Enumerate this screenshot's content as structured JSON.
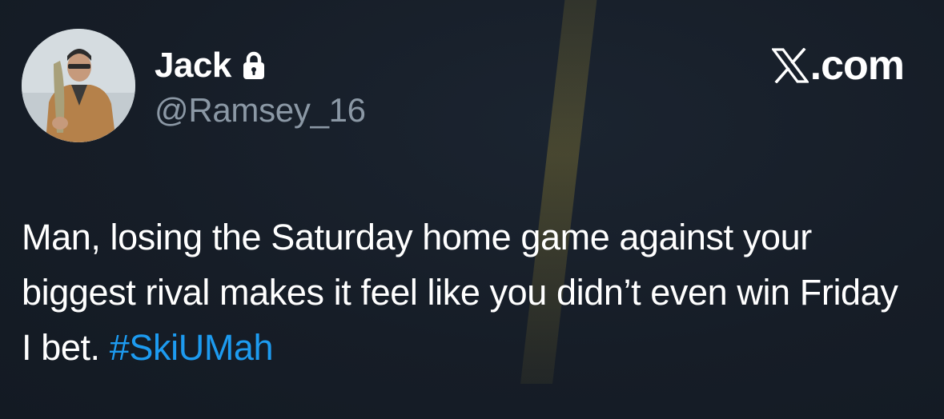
{
  "header": {
    "display_name": "Jack",
    "handle": "@Ramsey_16",
    "brand": ".com",
    "lock_icon": "lock-icon",
    "brand_icon": "x-logo-icon"
  },
  "tweet": {
    "text": "Man, losing the Saturday home game against your biggest rival makes it feel like you didn’t even win Friday I bet. ",
    "hashtag": "#SkiUMah"
  },
  "colors": {
    "background": "#151c26",
    "text": "#ffffff",
    "secondary_text": "#8b98a5",
    "link": "#1d9bf0"
  }
}
